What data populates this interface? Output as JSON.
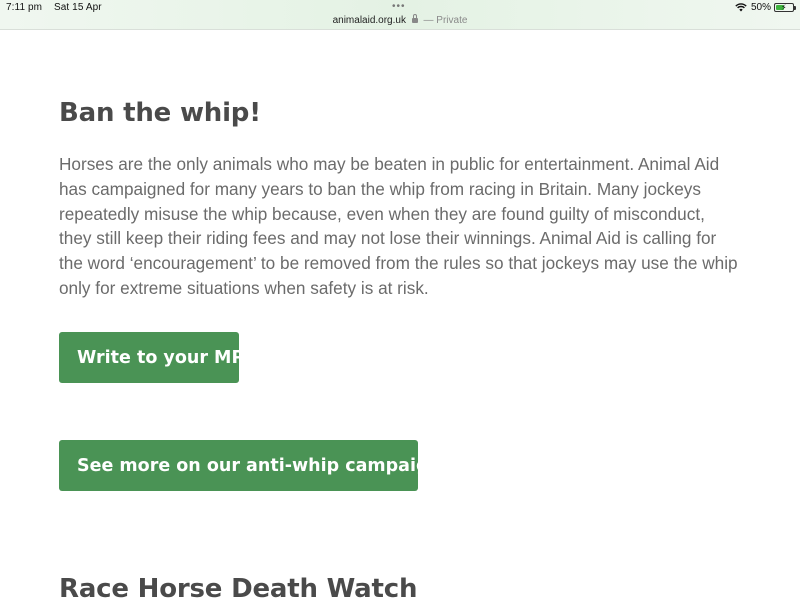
{
  "status_bar": {
    "time": "7:11 pm",
    "date": "Sat 15 Apr",
    "battery_percent": "50%",
    "battery_level": 0.5,
    "wifi_icon": "wifi-icon",
    "battery_icon": "battery-charging-icon"
  },
  "url_bar": {
    "domain": "animalaid.org.uk",
    "privacy": "— Private",
    "lock_icon": "lock-icon",
    "grabber_icon": "more-dots-icon"
  },
  "main": {
    "heading": "Ban the whip!",
    "body": "Horses are the only animals who may be beaten in public for entertainment. Animal Aid has campaigned for many years to ban the whip from racing in Britain. Many jockeys repeatedly misuse the whip because, even when they are found guilty of misconduct, they still keep their riding fees and may not lose their winnings. Animal Aid is calling for the word ‘encouragement’ to be removed from the rules so that jockeys may use the whip only for extreme situations when safety is at risk.",
    "buttons": [
      {
        "label": "Write to your MP"
      },
      {
        "label": "See more on our anti-whip campaign"
      }
    ],
    "next_heading": "Race Horse Death Watch"
  },
  "colors": {
    "button_green": "#4a9355",
    "heading_text": "#4a4a4a",
    "body_text": "#6b6b6b",
    "topbar_tint": "#e4f2e4"
  }
}
